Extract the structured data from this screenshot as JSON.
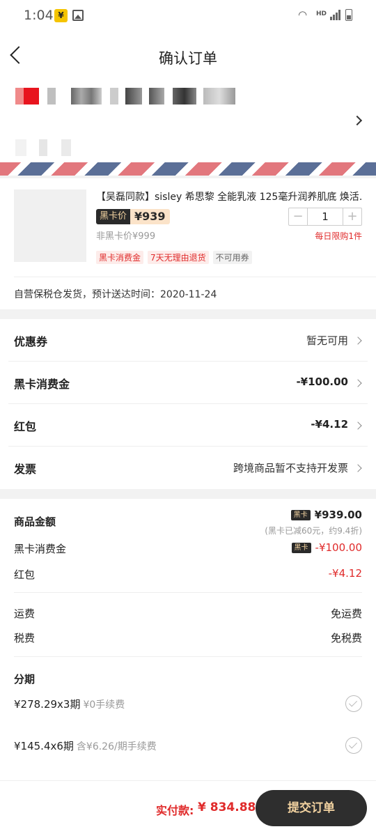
{
  "status_bar": {
    "time": "1:04",
    "yen_badge": "¥",
    "network": "HD"
  },
  "nav": {
    "title": "确认订单"
  },
  "product": {
    "name": "【吴磊同款】sisley 希思黎 全能乳液 125毫升润养肌底 焕活…",
    "black_card_label": "黑卡价",
    "black_card_price": "¥939",
    "non_black_price": "非黑卡价¥999",
    "quantity": "1",
    "minus": "−",
    "plus": "+",
    "limit": "每日限购1件",
    "tags": [
      "黑卡消费金",
      "7天无理由退货",
      "不可用券"
    ],
    "shipping": "自营保税仓发货，预计送达时间：2020-11-24"
  },
  "options": [
    {
      "label": "优惠券",
      "value": "暂无可用"
    },
    {
      "label": "黑卡消费金",
      "value": "-¥100.00"
    },
    {
      "label": "红包",
      "value": "-¥4.12"
    },
    {
      "label": "发票",
      "value": "跨境商品暂不支持开发票"
    }
  ],
  "summary": {
    "goods_label": "商品金额",
    "goods_badge": "黑卡",
    "goods_value": "¥939.00",
    "goods_note": "(黑卡已减60元，约9.4折)",
    "credit_label": "黑卡消费金",
    "credit_badge": "黑卡",
    "credit_value": "-¥100.00",
    "hongbao_label": "红包",
    "hongbao_value": "-¥4.12",
    "freight_label": "运费",
    "freight_value": "免运费",
    "tax_label": "税费",
    "tax_value": "免税费",
    "installment_title": "分期",
    "installments": [
      {
        "plan": "¥278.29x3期",
        "fee": "¥0手续费"
      },
      {
        "plan": "¥145.4x6期",
        "fee": "含¥6.26/期手续费"
      }
    ]
  },
  "footer": {
    "total_label": "实付款:",
    "total_value": "¥ 834.88",
    "submit_label": "提交订单"
  },
  "colors": {
    "accent_red": "#e02b2b",
    "black_card": "#2a2a2a",
    "gold": "#f2d2a0",
    "envelope_blue": "#5b6f97",
    "envelope_red": "#e2777d"
  }
}
